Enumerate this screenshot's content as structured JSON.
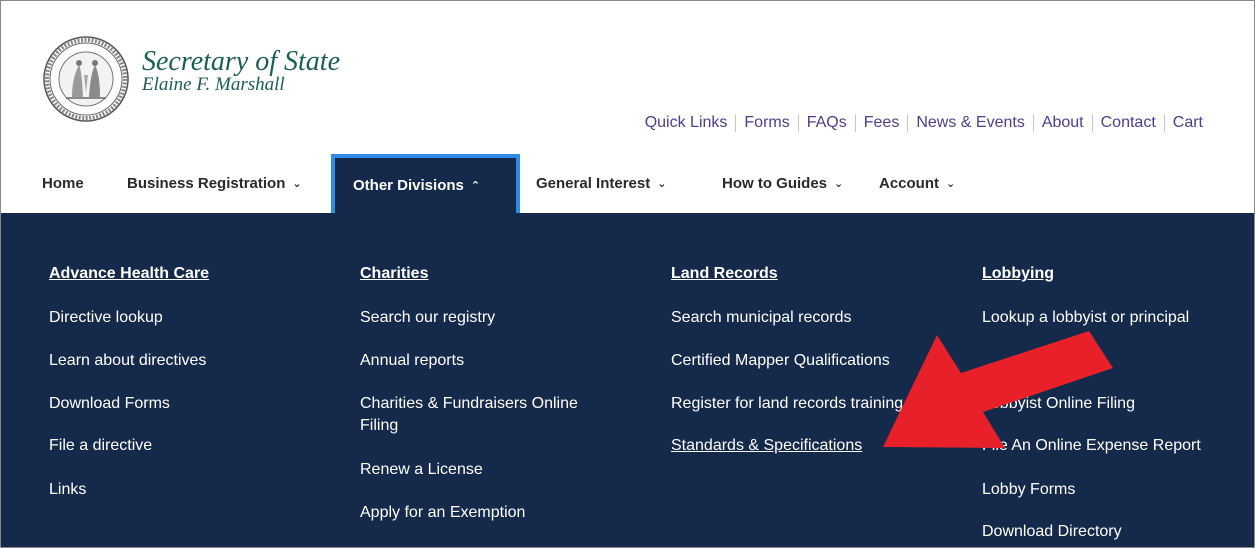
{
  "header": {
    "title": "Secretary of State",
    "subtitle": "Elaine F. Marshall",
    "seal_icon": "nc-state-seal-icon"
  },
  "quick_links": [
    "Quick Links",
    "Forms",
    "FAQs",
    "Fees",
    "News & Events",
    "About",
    "Contact",
    "Cart"
  ],
  "nav": {
    "home": "Home",
    "business_registration": "Business Registration",
    "other_divisions": "Other Divisions",
    "general_interest": "General Interest",
    "how_to_guides": "How to Guides",
    "account": "Account"
  },
  "mega_menu": {
    "advance_health_care": {
      "heading": "Advance Health Care",
      "links": [
        "Directive lookup",
        "Learn about directives",
        "Download Forms",
        "File a directive",
        "Links"
      ]
    },
    "charities": {
      "heading": "Charities",
      "links": [
        "Search our registry",
        "Annual reports",
        "Charities & Fundraisers Online",
        "Filing",
        "Renew a License",
        "Apply for an Exemption"
      ]
    },
    "land_records": {
      "heading": "Land Records",
      "links": [
        "Search municipal records",
        "Certified Mapper Qualifications",
        "Register for land records training",
        "Standards & Specifications"
      ]
    },
    "lobbying": {
      "heading": "Lobbying",
      "links": [
        "Lookup a lobbyist or principal",
        "Lobbyist Online Filing",
        "File An Online Expense Report",
        "Lobby Forms",
        "Download Directory"
      ]
    }
  },
  "colors": {
    "nav_bg": "#152a4a",
    "active_border": "#2e8ce6",
    "title_green": "#1b5e55",
    "link_purple": "#4a3f8c",
    "arrow_red": "#e8202a"
  },
  "annotation_icon": "red-pointer-arrow-icon"
}
